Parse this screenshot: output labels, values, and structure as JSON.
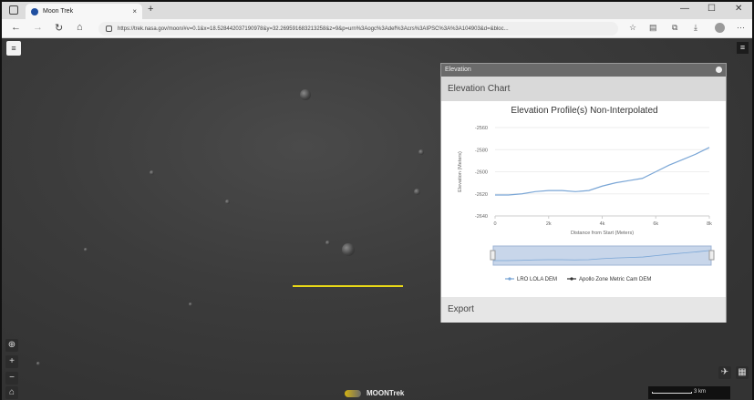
{
  "browser": {
    "tab_title": "Moon Trek",
    "new_tab": "+",
    "tab_close": "×",
    "url": "https://trek.nasa.gov/moon/#v=0.1&x=18.528442037190978&y=32.269591683213258&z=9&p=urn%3Aogc%3Adef%3Acrs%3AIPSC%3A%3A104903&d=&bloc...",
    "controls": {
      "minimize": "—",
      "maximize": "☐",
      "close": "✕"
    },
    "nav": {
      "back": "←",
      "forward": "→",
      "reload": "↻",
      "home": "⌂"
    }
  },
  "map": {
    "layers_icon": "≡",
    "menu_icon": "≡",
    "tools": {
      "locate": "⊕",
      "zoom_in": "+",
      "zoom_out": "−",
      "home": "⌂"
    },
    "right_tools": {
      "measure": "✈",
      "basemap": "▦"
    },
    "logo_text": "MOONTrek",
    "scale_label": "3 km"
  },
  "panel": {
    "title": "Elevation",
    "section": "Elevation Chart",
    "export": "Export"
  },
  "chart_data": {
    "type": "line",
    "title": "Elevation Profile(s) Non-Interpolated",
    "xlabel": "Distance from Start (Meters)",
    "ylabel": "Elevation (Meters)",
    "xlim": [
      0,
      8000
    ],
    "ylim": [
      -2640,
      -2560
    ],
    "xticks": [
      {
        "v": 0,
        "t": "0"
      },
      {
        "v": 2000,
        "t": "2k"
      },
      {
        "v": 4000,
        "t": "4k"
      },
      {
        "v": 6000,
        "t": "6k"
      },
      {
        "v": 8000,
        "t": "8k"
      }
    ],
    "yticks": [
      {
        "v": -2560,
        "t": "-2560"
      },
      {
        "v": -2580,
        "t": "-2580"
      },
      {
        "v": -2600,
        "t": "-2600"
      },
      {
        "v": -2620,
        "t": "-2620"
      },
      {
        "v": -2640,
        "t": "-2640"
      }
    ],
    "series": [
      {
        "name": "LRO LOLA DEM",
        "color": "#7aa6d6",
        "x": [
          0,
          500,
          1000,
          1500,
          2000,
          2500,
          3000,
          3500,
          4000,
          4500,
          5000,
          5500,
          6000,
          6500,
          7000,
          7500,
          8000
        ],
        "y": [
          -2621,
          -2621,
          -2620,
          -2618,
          -2617,
          -2617,
          -2618,
          -2617,
          -2613,
          -2610,
          -2608,
          -2606,
          -2600,
          -2594,
          -2589,
          -2584,
          -2578
        ]
      },
      {
        "name": "Apollo Zone Metric Cam DEM",
        "color": "#333333",
        "x": [],
        "y": []
      }
    ]
  }
}
